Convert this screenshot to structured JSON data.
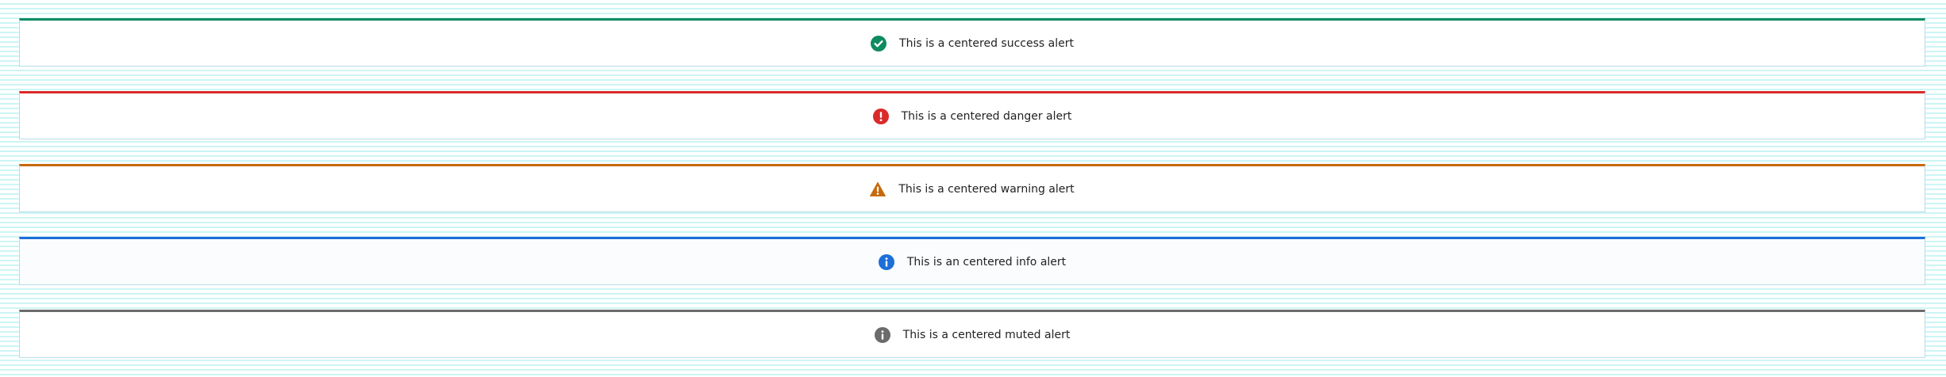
{
  "alerts": [
    {
      "type": "success",
      "icon": "check-circle-icon",
      "color": "#0d8a61",
      "text": "This is a centered success alert"
    },
    {
      "type": "danger",
      "icon": "exclamation-circle-icon",
      "color": "#da2a2a",
      "text": "This is a centered danger alert"
    },
    {
      "type": "warning",
      "icon": "warning-triangle-icon",
      "color": "#c76a0b",
      "text": "This is a centered warning alert"
    },
    {
      "type": "info",
      "icon": "info-circle-icon",
      "color": "#1c6fd8",
      "text": "This is an centered info alert"
    },
    {
      "type": "muted",
      "icon": "info-circle-icon",
      "color": "#6b6b6b",
      "text": "This is a centered muted alert"
    }
  ]
}
